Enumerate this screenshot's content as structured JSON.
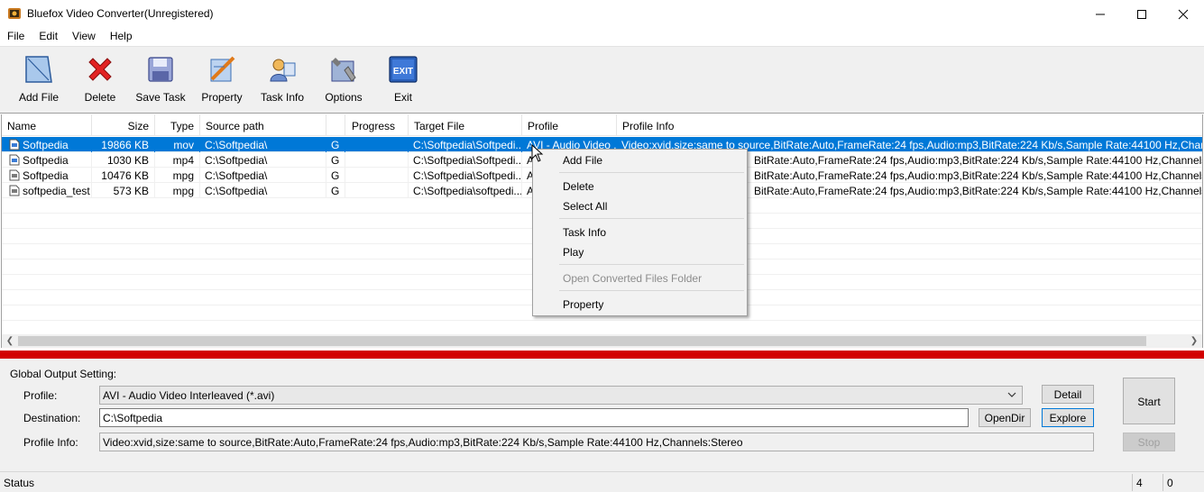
{
  "window": {
    "title": "Bluefox Video Converter(Unregistered)"
  },
  "menubar": [
    "File",
    "Edit",
    "View",
    "Help"
  ],
  "toolbar": [
    {
      "label": "Add File",
      "icon": "add-file-icon"
    },
    {
      "label": "Delete",
      "icon": "delete-icon"
    },
    {
      "label": "Save Task",
      "icon": "save-task-icon"
    },
    {
      "label": "Property",
      "icon": "property-icon"
    },
    {
      "label": "Task Info",
      "icon": "task-info-icon"
    },
    {
      "label": "Options",
      "icon": "options-icon"
    },
    {
      "label": "Exit",
      "icon": "exit-icon"
    }
  ],
  "list": {
    "columns": [
      "Name",
      "Size",
      "Type",
      "Source path",
      "",
      "Progress",
      "Target File",
      "Profile",
      "Profile Info"
    ],
    "rows": [
      {
        "name": "Softpedia",
        "size": "19866 KB",
        "type": "mov",
        "source": "C:\\Softpedia\\",
        "flag": "G",
        "progress": "",
        "target": "C:\\Softpedia\\Softpedi...",
        "profile": "AVI - Audio Video ...",
        "info": "Video:xvid,size:same to source,BitRate:Auto,FrameRate:24 fps,Audio:mp3,BitRate:224 Kb/s,Sample Rate:44100 Hz,Channels:Stereo",
        "selected": true
      },
      {
        "name": "Softpedia",
        "size": "1030 KB",
        "type": "mp4",
        "source": "C:\\Softpedia\\",
        "flag": "G",
        "progress": "",
        "target": "C:\\Softpedia\\Softpedi...",
        "profile": "A",
        "info": "BitRate:Auto,FrameRate:24 fps,Audio:mp3,BitRate:224 Kb/s,Sample Rate:44100 Hz,Channels:Stereo",
        "selected": false
      },
      {
        "name": "Softpedia",
        "size": "10476 KB",
        "type": "mpg",
        "source": "C:\\Softpedia\\",
        "flag": "G",
        "progress": "",
        "target": "C:\\Softpedia\\Softpedi...",
        "profile": "A",
        "info": "BitRate:Auto,FrameRate:24 fps,Audio:mp3,BitRate:224 Kb/s,Sample Rate:44100 Hz,Channels:Stereo",
        "selected": false
      },
      {
        "name": "softpedia_test",
        "size": "573 KB",
        "type": "mpg",
        "source": "C:\\Softpedia\\",
        "flag": "G",
        "progress": "",
        "target": "C:\\Softpedia\\softpedi...",
        "profile": "A",
        "info": "BitRate:Auto,FrameRate:24 fps,Audio:mp3,BitRate:224 Kb/s,Sample Rate:44100 Hz,Channels:Stereo",
        "selected": false
      }
    ]
  },
  "context_menu": {
    "items": [
      {
        "label": "Add File",
        "enabled": true
      },
      {
        "label": "Delete",
        "enabled": true
      },
      {
        "label": "Select All",
        "enabled": true
      },
      {
        "label": "Task Info",
        "enabled": true
      },
      {
        "label": "Play",
        "enabled": true
      },
      {
        "label": "Open Converted Files Folder",
        "enabled": false
      },
      {
        "label": "Property",
        "enabled": true
      }
    ]
  },
  "output": {
    "section_label": "Global Output Setting:",
    "profile_label": "Profile:",
    "profile_value": "AVI - Audio Video Interleaved (*.avi)",
    "destination_label": "Destination:",
    "destination_value": "C:\\Softpedia",
    "profile_info_label": "Profile Info:",
    "profile_info_value": "Video:xvid,size:same to source,BitRate:Auto,FrameRate:24 fps,Audio:mp3,BitRate:224 Kb/s,Sample Rate:44100 Hz,Channels:Stereo",
    "detail_button": "Detail",
    "opendir_button": "OpenDir",
    "explore_button": "Explore",
    "start_button": "Start",
    "stop_button": "Stop"
  },
  "status": {
    "text": "Status",
    "count1": "4",
    "count2": "0"
  },
  "colors": {
    "selection": "#0078d7",
    "divider_bar": "#d20000"
  }
}
